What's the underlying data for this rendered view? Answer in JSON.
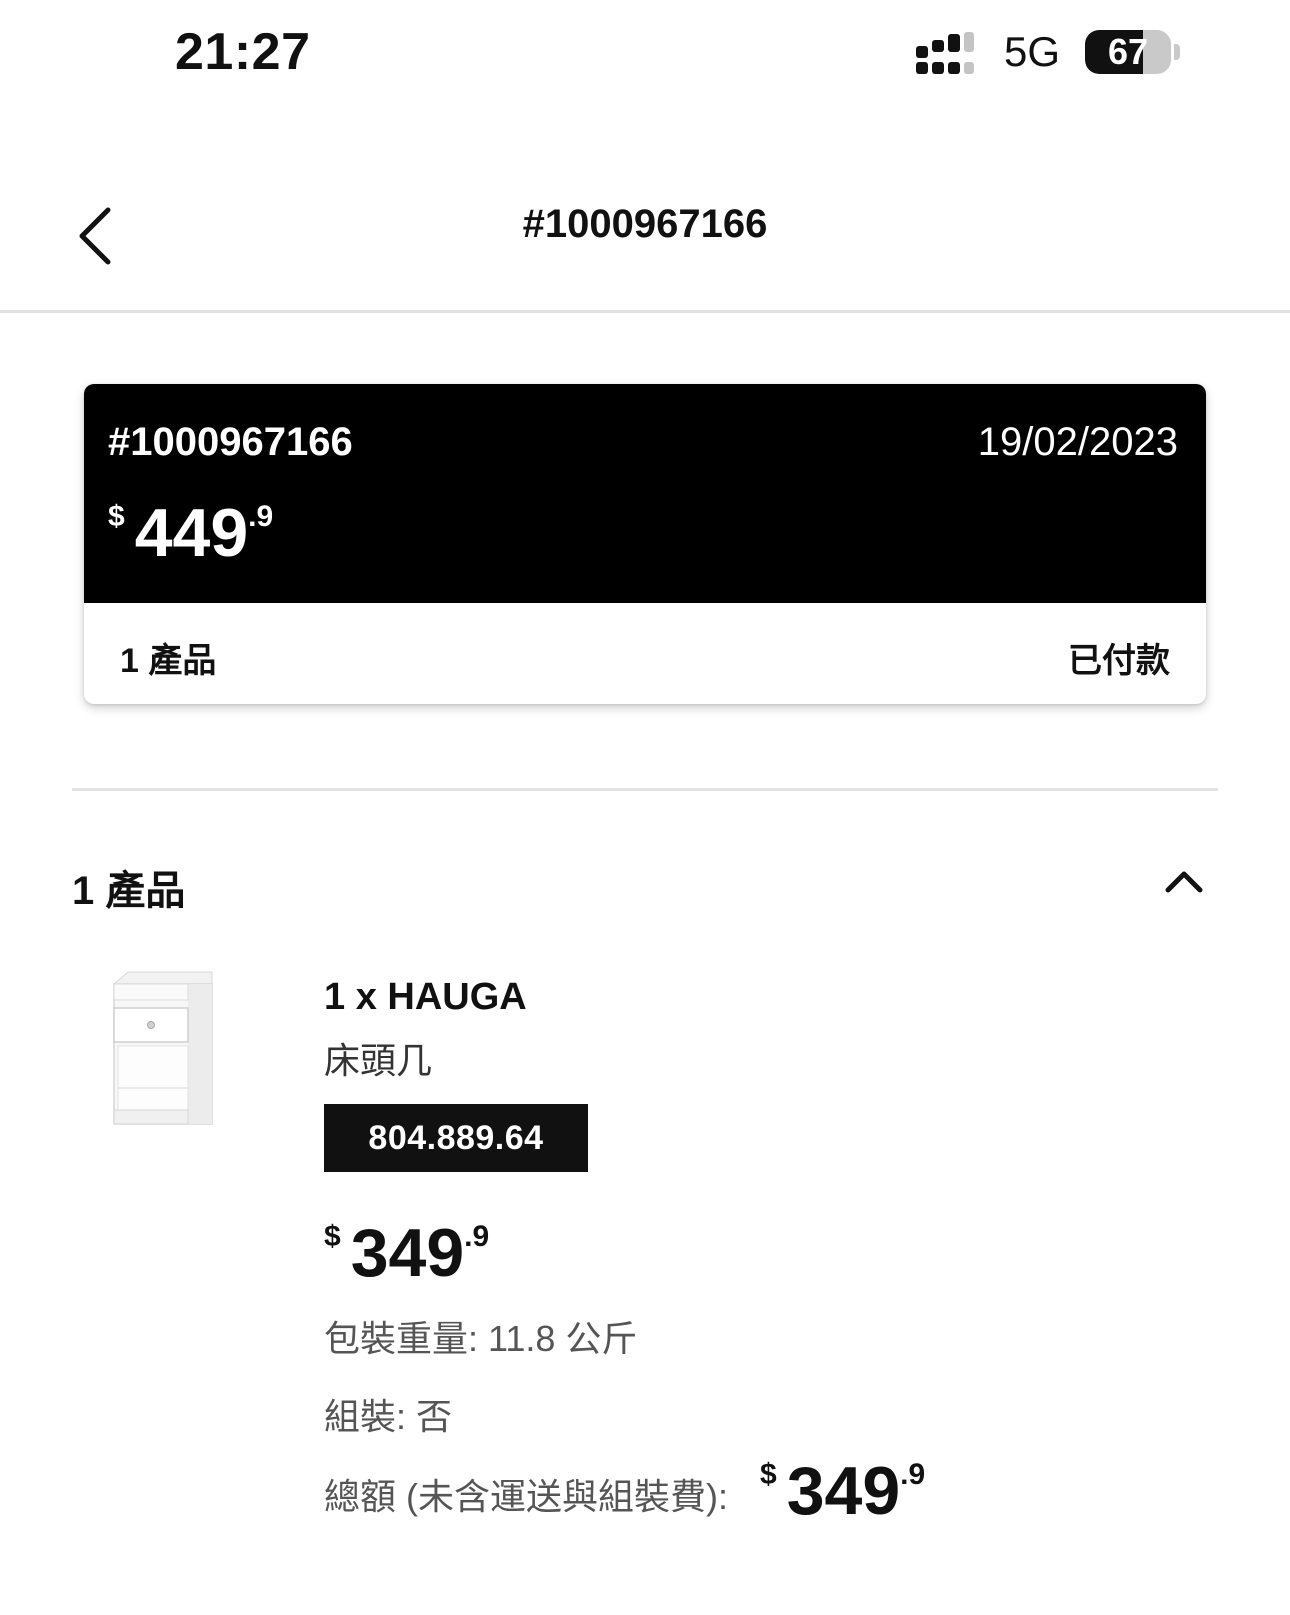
{
  "status_bar": {
    "time": "21:27",
    "network": "5G",
    "battery": "67",
    "battery_level": 0.67
  },
  "header": {
    "title": "#1000967166"
  },
  "summary_card": {
    "order_number": "#1000967166",
    "date": "19/02/2023",
    "price": {
      "currency": "$",
      "integer": "449",
      "decimal": ".9"
    },
    "item_count": "1 產品",
    "payment_status": "已付款"
  },
  "products_section": {
    "title": "1 產品",
    "items": [
      {
        "name": "1 x HAUGA",
        "description": "床頭几",
        "article_number": "804.889.64",
        "price": {
          "currency": "$",
          "integer": "349",
          "decimal": ".9"
        },
        "weight": "包裝重量: 11.8 公斤",
        "assembly": "組裝: 否",
        "total_label": "總額 (未含運送與組裝費):",
        "total": {
          "currency": "$",
          "integer": "349",
          "decimal": ".9"
        }
      }
    ]
  },
  "colors": {
    "card_dark": "#000000",
    "text_primary": "#111111",
    "text_secondary": "#555555",
    "divider": "#e2e2e2"
  },
  "icons": [
    "signal-icon",
    "battery-icon",
    "back-arrow-icon",
    "chevron-up-icon"
  ]
}
